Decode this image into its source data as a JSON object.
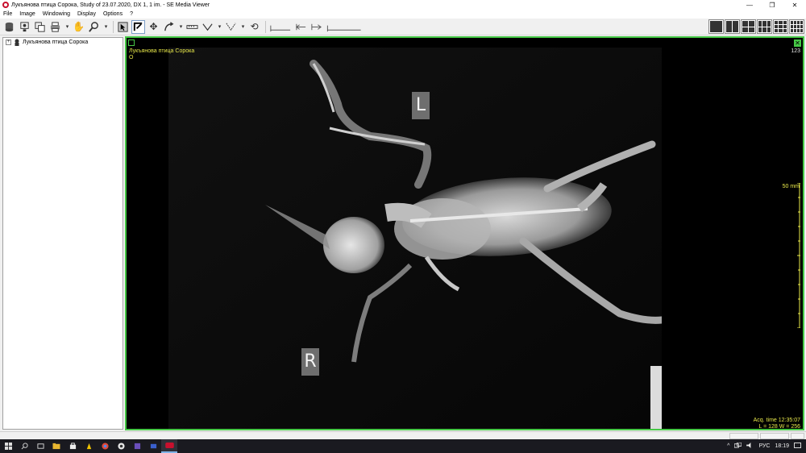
{
  "window": {
    "title": "Лукъянова птица Сорока, Study of  23.07.2020, DX 1, 1 im. - SE Media Viewer",
    "minimize_glyph": "—",
    "restore_glyph": "❐",
    "close_glyph": "✕"
  },
  "menu": [
    "File",
    "Image",
    "Windowing",
    "Display",
    "Options",
    "?"
  ],
  "toolbar": {
    "icons": [
      "database-icon",
      "patient-icon",
      "series-icon",
      "print-icon",
      "pan-hand-icon",
      "zoom-icon",
      "select-icon",
      "annotate-icon",
      "move-icon",
      "curve-icon",
      "ruler-icon",
      "angle-icon",
      "roi-icon",
      "rotate-icon",
      "measure-icon"
    ]
  },
  "tree": {
    "expand_glyph": "+",
    "label": "Лукъянова птица Сорока"
  },
  "viewer": {
    "patient_name": "Лукъянова птица Сорока",
    "orientation_top_left": "O",
    "image_number": "123",
    "scale_label": "50 mm",
    "marker_left": "L",
    "marker_right": "R",
    "acq_time": "Acq. time 12:35:07",
    "window_level": "L = 128   W = 256",
    "close_glyph": "✕"
  },
  "taskbar": {
    "language": "РУС",
    "time": "18:19"
  },
  "colors": {
    "viewer_border": "#46c846",
    "overlay_yellow": "#e8e84a",
    "marker_bg": "#6e6e6e"
  }
}
